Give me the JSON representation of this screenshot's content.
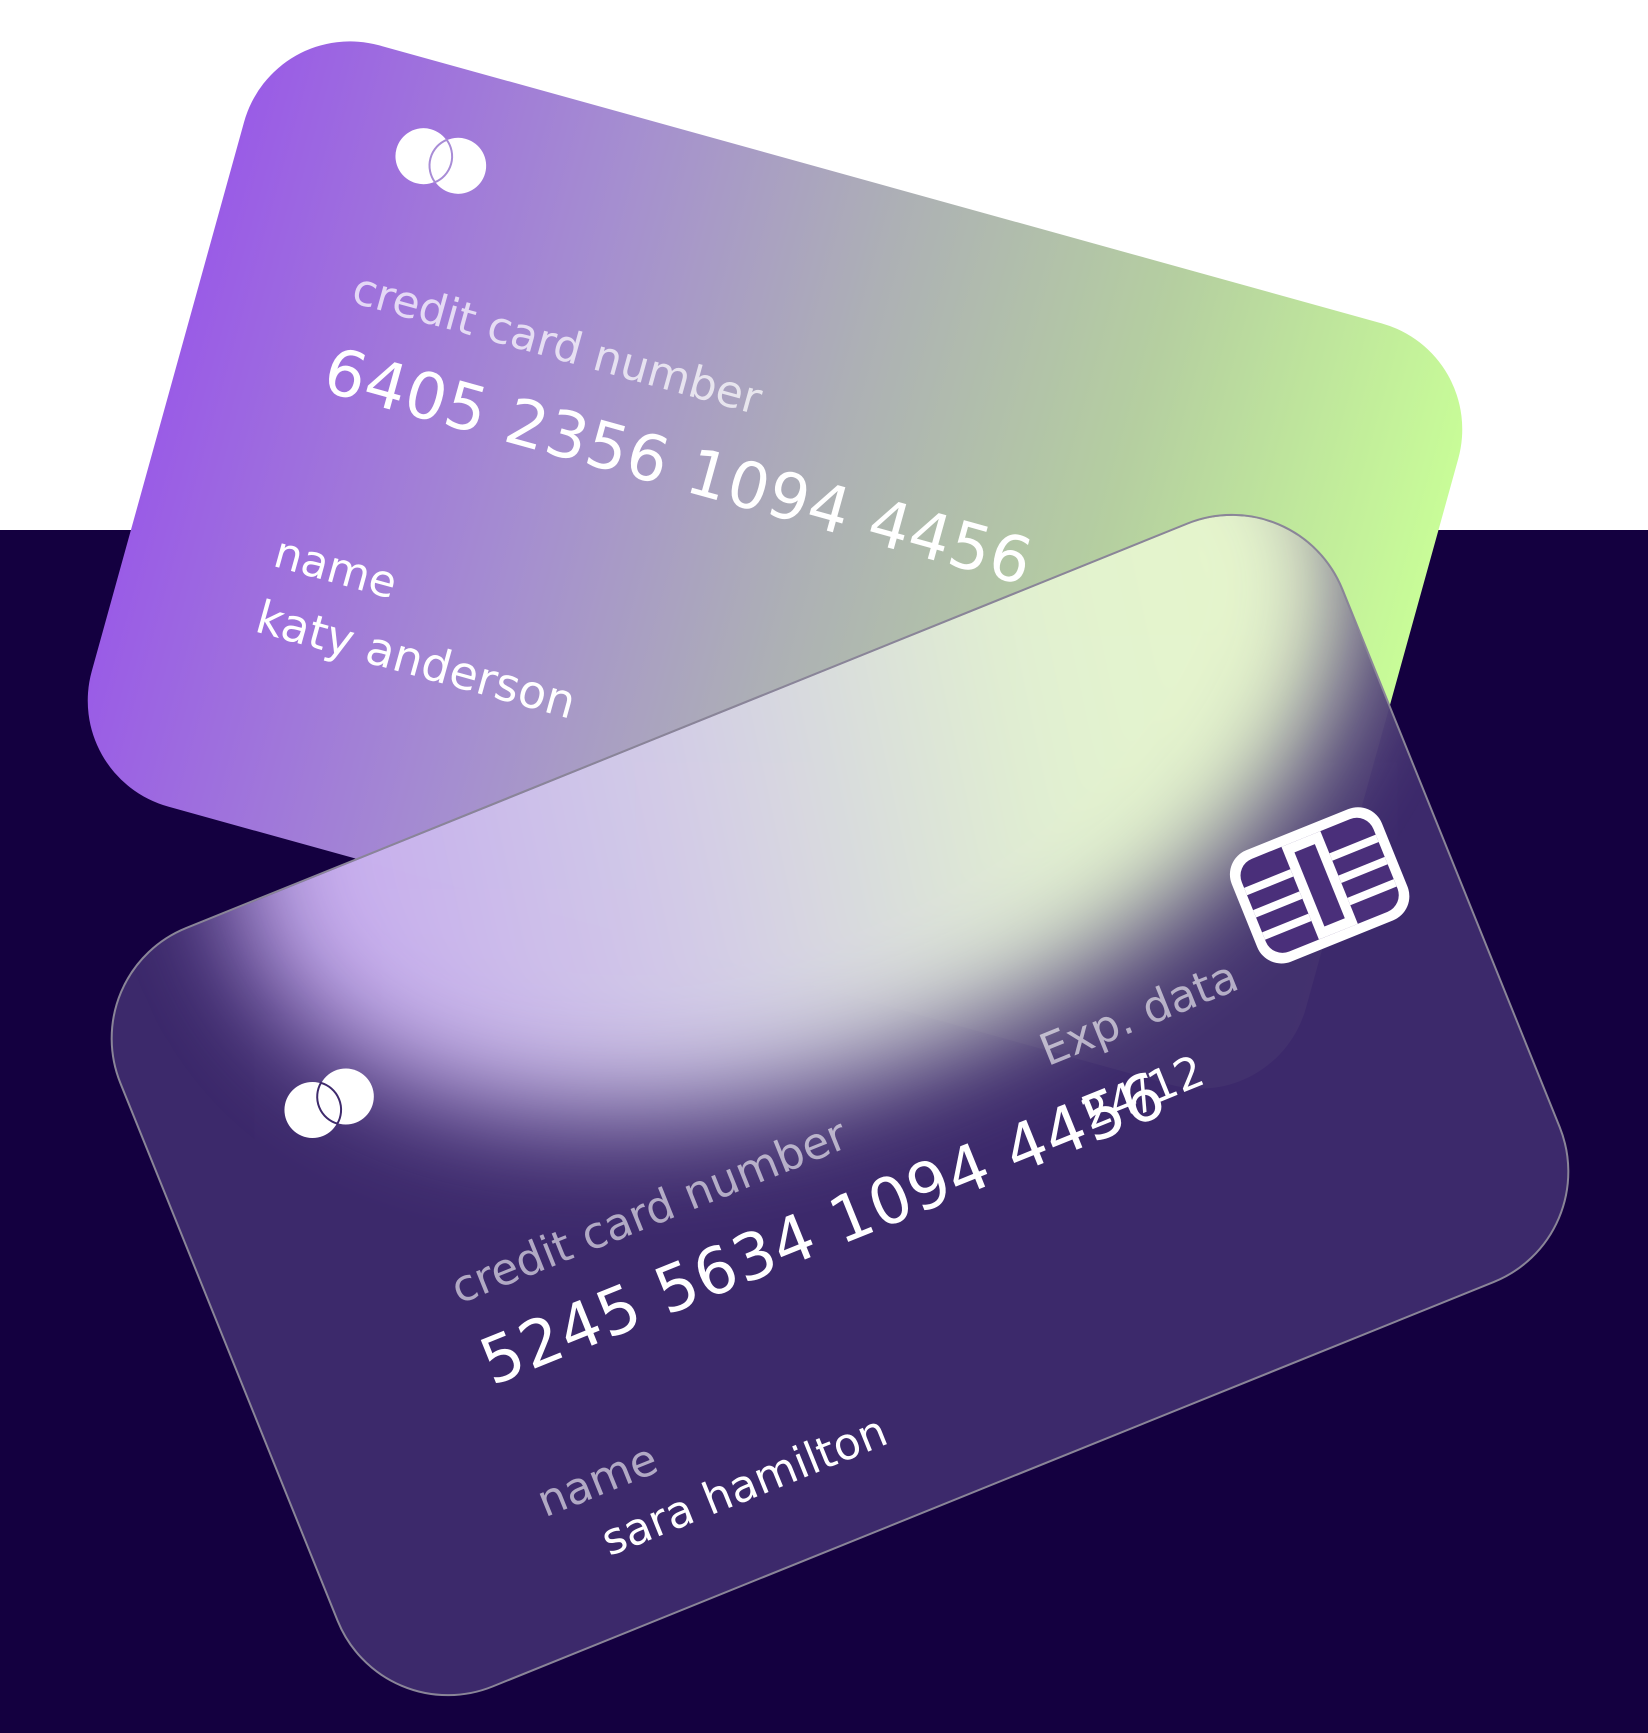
{
  "back_card": {
    "logo_icon": "card-brand-circles-icon",
    "number_label": "credit card number",
    "number": "6405 2356 1094 4456",
    "name_label": "name",
    "name": "katy anderson",
    "gradient": [
      "#9a5ce6",
      "#c8fc98"
    ]
  },
  "front_card": {
    "logo_icon": "card-brand-circles-icon",
    "number_label": "credit card number",
    "number": "5245 5634 1094 4456",
    "exp_label": "Exp. data",
    "exp": "24/12",
    "name_label": "name",
    "name": "sara hamilton",
    "chip_icon": "emv-chip-icon",
    "background": "#3e2a6c"
  },
  "colors": {
    "background_top": "#ffffff",
    "background_bottom": "#140040"
  }
}
